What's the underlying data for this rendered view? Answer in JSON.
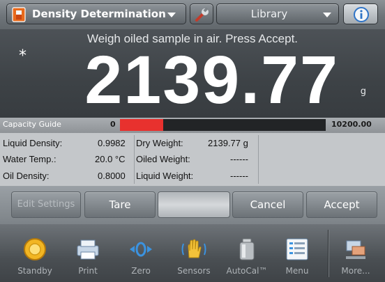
{
  "header": {
    "app_name": "Density Determination",
    "library_label": "Library",
    "icons": {
      "app": "density-app-icon",
      "settings": "wrench-icon",
      "info": "info-icon"
    }
  },
  "display": {
    "prompt": "Weigh oiled sample in air. Press Accept.",
    "stability_marker": "*",
    "weight": "2139.77",
    "unit": "g"
  },
  "capacity_guide": {
    "label": "Capacity Guide",
    "min": "0",
    "max": "10200.00",
    "fill_fraction": 0.21,
    "fill_color": "#e8312e"
  },
  "results": {
    "liquid_density_label": "Liquid Density:",
    "liquid_density_value": "0.9982",
    "water_temp_label": "Water Temp.:",
    "water_temp_value": "20.0 °C",
    "oil_density_label": "Oil Density:",
    "oil_density_value": "0.8000",
    "dry_weight_label": "Dry Weight:",
    "dry_weight_value": "2139.77 g",
    "oiled_weight_label": "Oiled Weight:",
    "oiled_weight_value": "------",
    "liquid_weight_label": "Liquid Weight:",
    "liquid_weight_value": "------"
  },
  "softkeys": {
    "edit_settings": "Edit Settings",
    "tare": "Tare",
    "cancel": "Cancel",
    "accept": "Accept"
  },
  "nav": {
    "standby": "Standby",
    "print": "Print",
    "zero": "Zero",
    "sensors": "Sensors",
    "autocal": "AutoCal™",
    "menu": "Menu",
    "more": "More..."
  }
}
